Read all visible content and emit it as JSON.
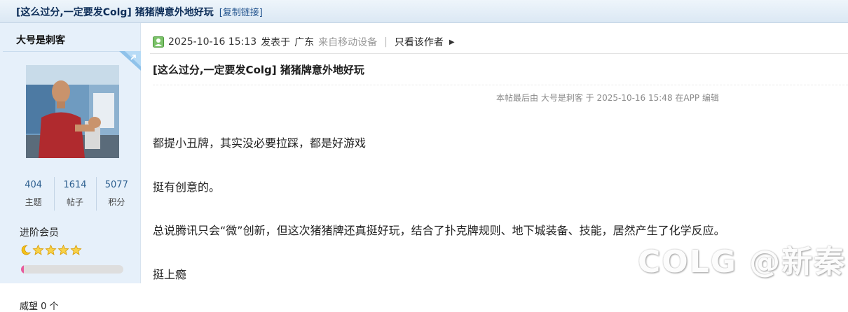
{
  "thread": {
    "title": "[这么过分,一定要发Colg] 猪猪牌意外地好玩",
    "copy_link": "[复制链接]"
  },
  "user": {
    "name": "大号是刺客",
    "stats": [
      {
        "value": "404",
        "label": "主题"
      },
      {
        "value": "1614",
        "label": "帖子"
      },
      {
        "value": "5077",
        "label": "积分"
      }
    ],
    "rank": "进阶会员",
    "level_progress_percent": 3,
    "extra": "威望          0  个"
  },
  "post": {
    "timestamp": "2025-10-16 15:13",
    "posted_at_label": "发表于",
    "location": "广东",
    "device": "来自移动设备",
    "separator": "|",
    "only_author": "只看该作者",
    "title": "[这么过分,一定要发Colg] 猪猪牌意外地好玩",
    "edit_note": "本帖最后由 大号是刺客 于 2025-10-16 15:48 在APP 编辑",
    "paragraphs": [
      "都提小丑牌，其实没必要拉踩，都是好游戏",
      "挺有创意的。",
      "总说腾讯只会“微”创新，但这次猪猪牌还真挺好玩，结合了扑克牌规则、地下城装备、技能，居然产生了化学反应。",
      "挺上瘾"
    ]
  },
  "watermark": "COLG @新秦",
  "colors": {
    "sidebar_bg": "#e6f0fa",
    "title_bar": "#dbe8f4",
    "link_blue": "#1c4e8a",
    "progress": "#e85a9d"
  }
}
